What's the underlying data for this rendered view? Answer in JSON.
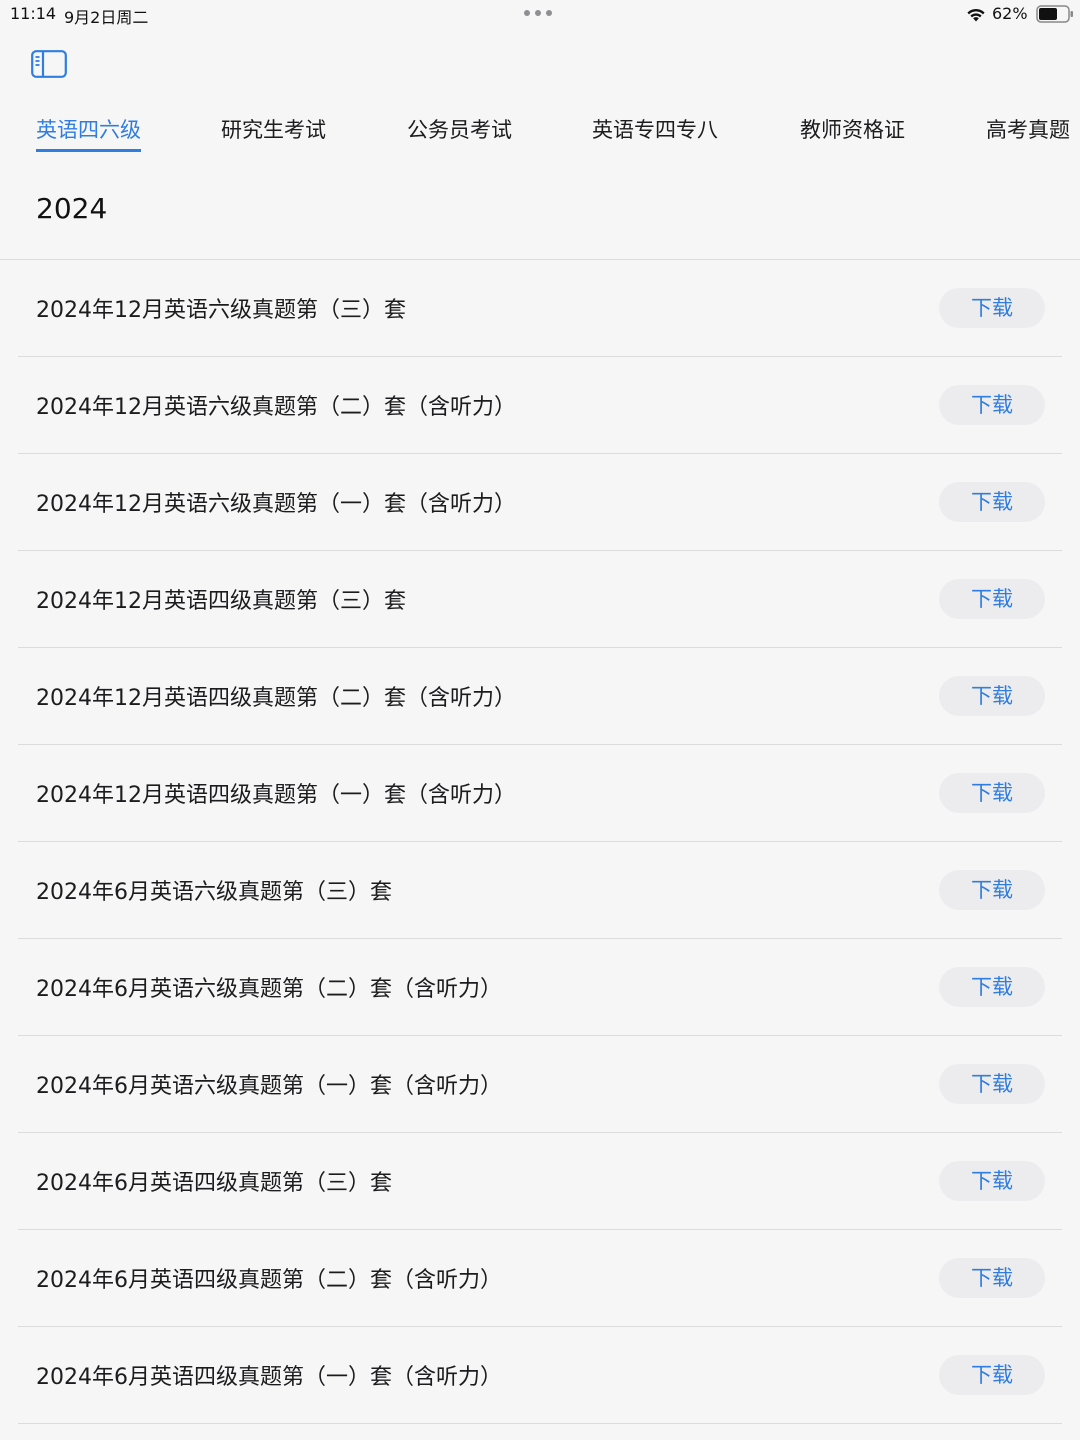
{
  "status": {
    "time": "11:14",
    "date": "9月2日周二",
    "battery": "62%"
  },
  "tabs": [
    {
      "label": "英语四六级",
      "active": true
    },
    {
      "label": "研究生考试"
    },
    {
      "label": "公务员考试"
    },
    {
      "label": "英语专四专八"
    },
    {
      "label": "教师资格证"
    },
    {
      "label": "高考真题"
    }
  ],
  "section": {
    "year": "2024"
  },
  "download_label": "下载",
  "items": [
    {
      "title": "2024年12月英语六级真题第（三）套"
    },
    {
      "title": "2024年12月英语六级真题第（二）套（含听力）"
    },
    {
      "title": "2024年12月英语六级真题第（一）套（含听力）"
    },
    {
      "title": "2024年12月英语四级真题第（三）套"
    },
    {
      "title": "2024年12月英语四级真题第（二）套（含听力）"
    },
    {
      "title": "2024年12月英语四级真题第（一）套（含听力）"
    },
    {
      "title": "2024年6月英语六级真题第（三）套"
    },
    {
      "title": "2024年6月英语六级真题第（二）套（含听力）"
    },
    {
      "title": "2024年6月英语六级真题第（一）套（含听力）"
    },
    {
      "title": "2024年6月英语四级真题第（三）套"
    },
    {
      "title": "2024年6月英语四级真题第（二）套（含听力）"
    },
    {
      "title": "2024年6月英语四级真题第（一）套（含听力）"
    }
  ],
  "colors": {
    "accent": "#2f7de1",
    "background": "#f6f6f6",
    "button_bg": "#ececee"
  },
  "icons": {
    "sidebar": "sidebar-icon",
    "wifi": "wifi-icon",
    "battery": "battery-icon",
    "multitask": "more-dots-icon"
  }
}
